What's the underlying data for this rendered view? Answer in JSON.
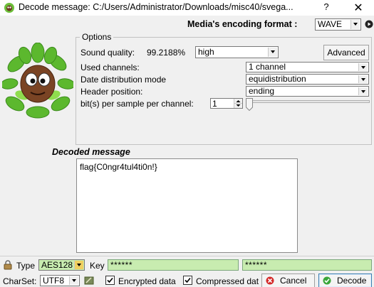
{
  "window": {
    "title": "Decode message: C:/Users/Administrator/Downloads/misc40/svega...",
    "help": "?",
    "close": "✕"
  },
  "format": {
    "label": "Media's encoding format :",
    "value": "WAVE"
  },
  "options": {
    "legend": "Options",
    "sound_quality_label": "Sound quality:",
    "sound_quality_percent": "99.2188%",
    "sound_quality_value": "high",
    "advanced_button": "Advanced",
    "used_channels_label": "Used channels:",
    "used_channels_value": "1 channel",
    "date_distribution_label": "Date distribution mode",
    "date_distribution_value": "equidistribution",
    "header_position_label": "Header position:",
    "header_position_value": "ending",
    "bits_label": "bit(s) per sample per channel:",
    "bits_value": "1"
  },
  "decoded": {
    "label": "Decoded message",
    "text": "flag{C0ngr4tul4ti0n!}"
  },
  "crypto": {
    "type_label": "Type",
    "type_value": "AES128",
    "key_label": "Key",
    "key_value": "******",
    "key_confirm_value": "******",
    "charset_label": "CharSet:",
    "charset_value": "UTF8",
    "encrypted_label": "Encrypted data",
    "compressed_label": "Compressed dat",
    "cancel_label": "Cancel",
    "decode_label": "Decode"
  },
  "colors": {
    "field_green": "#c8ecb0",
    "leaf_green": "#5cb82e",
    "cancel_red": "#d42a2a",
    "decode_green": "#3aa63a"
  }
}
